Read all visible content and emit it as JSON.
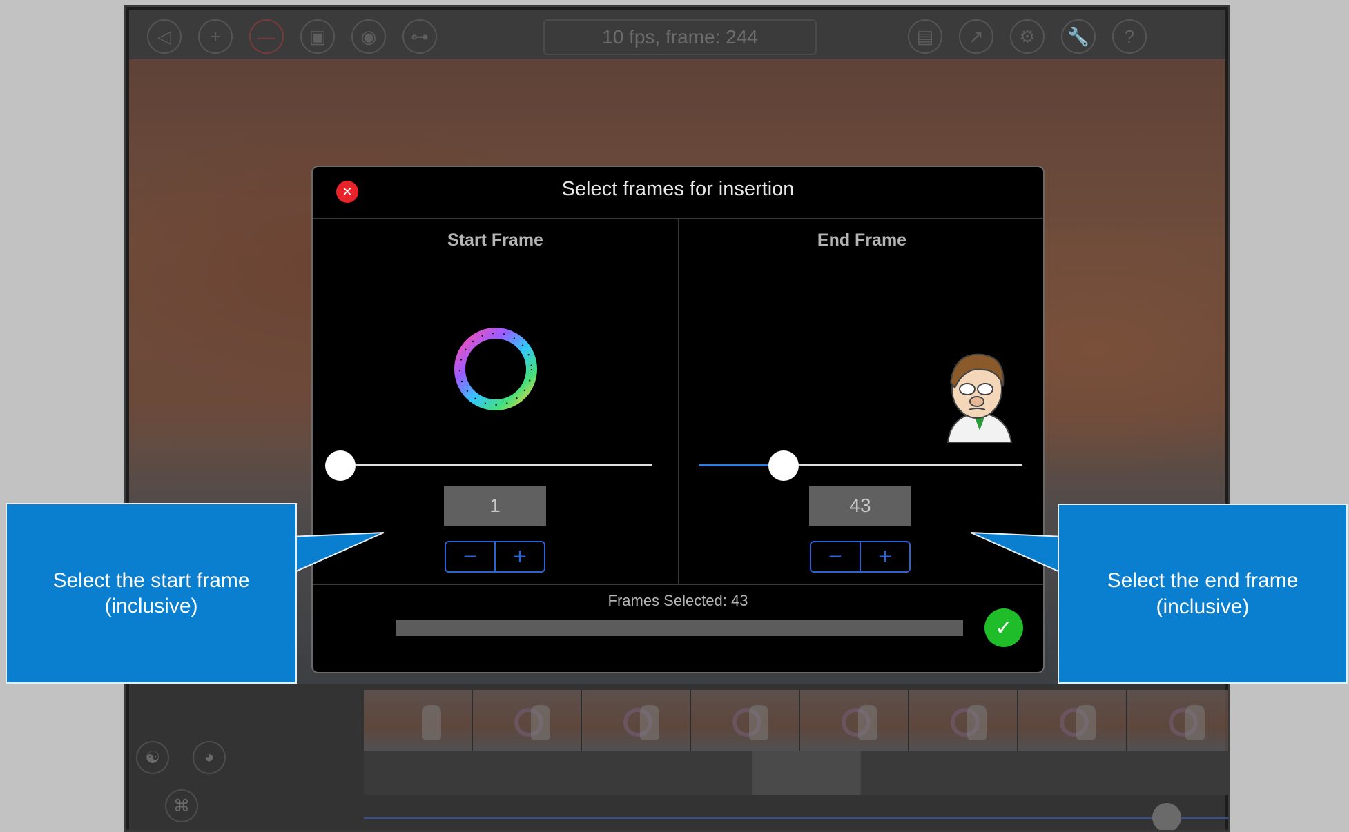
{
  "app": {
    "status_text": "10 fps, frame: 244",
    "toolbar_icons": [
      "back-icon",
      "plus-icon",
      "minus-icon",
      "camera-icon",
      "photo-icon",
      "key-icon",
      "clipboard-icon",
      "export-icon",
      "gear-icon",
      "wrench-icon",
      "help-icon"
    ]
  },
  "modal": {
    "title": "Select frames for insertion",
    "start": {
      "heading": "Start Frame",
      "value": "1",
      "slider_fraction": 0.0
    },
    "end": {
      "heading": "End Frame",
      "value": "43",
      "slider_fraction": 0.26
    },
    "frames_selected": "Frames Selected: 43",
    "accent_color": "#2b7de9",
    "close_color": "#e8232a",
    "confirm_color": "#1fbd2a"
  },
  "callouts": {
    "left": {
      "line1": "Select the start frame",
      "line2": "(inclusive)"
    },
    "right": {
      "line1": "Select the end frame",
      "line2": "(inclusive)"
    },
    "color": "#0a7fd0"
  }
}
